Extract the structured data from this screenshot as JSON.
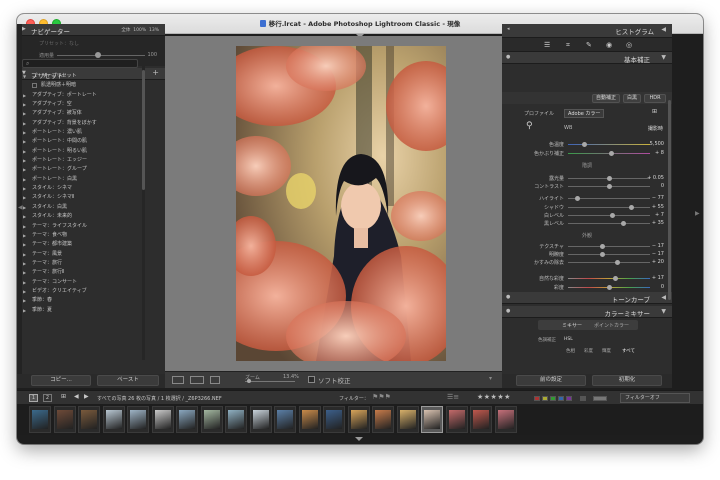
{
  "window": {
    "title": "移行.lrcat - Adobe Photoshop Lightroom Classic - 現像"
  },
  "navigator": {
    "header": "ナビゲーター",
    "zoom_fit": "全体",
    "zoom_100": "100%",
    "zoom_ratio": "13%",
    "preset_label": "プリセット：なし",
    "amount_label": "適用量",
    "amount_value": "100"
  },
  "presets": {
    "header": "プリセット",
    "search_placeholder": "",
    "items": [
      {
        "label": "ユーザープリセット",
        "type": "user"
      },
      {
        "label": "肌透明感＋明暗",
        "type": "sub"
      },
      {
        "label": "アダプティブ：ポートレート",
        "type": "item"
      },
      {
        "label": "アダプティブ：空",
        "type": "item"
      },
      {
        "label": "アダプティブ：被写体",
        "type": "item"
      },
      {
        "label": "アダプティブ：背景をぼかす",
        "type": "item"
      },
      {
        "label": "ポートレート：濃い肌",
        "type": "item"
      },
      {
        "label": "ポートレート：中間の肌",
        "type": "item"
      },
      {
        "label": "ポートレート：明るい肌",
        "type": "item"
      },
      {
        "label": "ポートレート：エッジー",
        "type": "item"
      },
      {
        "label": "ポートレート：グループ",
        "type": "item"
      },
      {
        "label": "ポートレート：白黒",
        "type": "item"
      },
      {
        "label": "スタイル：シネマ",
        "type": "item"
      },
      {
        "label": "スタイル：シネマⅡ",
        "type": "item"
      },
      {
        "label": "スタイル：白黒",
        "type": "item"
      },
      {
        "label": "スタイル：未来的",
        "type": "item"
      },
      {
        "label": "テーマ：ライフスタイル",
        "type": "item"
      },
      {
        "label": "テーマ：食べ物",
        "type": "item"
      },
      {
        "label": "テーマ：都市建築",
        "type": "item"
      },
      {
        "label": "テーマ：風景",
        "type": "item"
      },
      {
        "label": "テーマ：旅行",
        "type": "item"
      },
      {
        "label": "テーマ：旅行Ⅱ",
        "type": "item"
      },
      {
        "label": "テーマ：コンサート",
        "type": "item"
      },
      {
        "label": "ビデオ：クリエイティブ",
        "type": "item"
      },
      {
        "label": "季節：春",
        "type": "item"
      },
      {
        "label": "季節：夏",
        "type": "item"
      }
    ],
    "copy_button": "コピー...",
    "paste_button": "ペースト"
  },
  "toolbar": {
    "zoom_label": "ズーム",
    "zoom_value": "13.4%",
    "softproof_label": "ソフト校正"
  },
  "histogram": {
    "header": "ヒストグラム"
  },
  "basic": {
    "header": "基本補正",
    "auto_button": "自動補正",
    "bw_button": "白黒",
    "hdr_button": "HDR",
    "profile_label": "プロファイル",
    "profile_value": "Adobe カラー",
    "wb_label": "WB",
    "wb_value": "撮影時",
    "tone_heading": "階調",
    "presence_heading": "外観",
    "rows": [
      {
        "label": "色温度",
        "value": "5,500",
        "pos": 0.2
      },
      {
        "label": "色かぶり補正",
        "value": "+ 8",
        "pos": 0.53
      },
      {
        "label": "露光量",
        "value": "+ 0.05",
        "pos": 0.51
      },
      {
        "label": "コントラスト",
        "value": "0",
        "pos": 0.5
      },
      {
        "label": "ハイライト",
        "value": "− 77",
        "pos": 0.12
      },
      {
        "label": "シャドウ",
        "value": "+ 55",
        "pos": 0.77
      },
      {
        "label": "白レベル",
        "value": "+ 7",
        "pos": 0.54
      },
      {
        "label": "黒レベル",
        "value": "+ 35",
        "pos": 0.68
      },
      {
        "label": "テクスチャ",
        "value": "− 17",
        "pos": 0.42
      },
      {
        "label": "明瞭度",
        "value": "− 17",
        "pos": 0.42
      },
      {
        "label": "かすみの除去",
        "value": "+ 20",
        "pos": 0.6
      },
      {
        "label": "自然な彩度",
        "value": "+ 17",
        "pos": 0.58
      },
      {
        "label": "彩度",
        "value": "0",
        "pos": 0.5
      }
    ]
  },
  "tonecurve": {
    "header": "トーンカーブ"
  },
  "colormixer": {
    "header": "カラーミキサー",
    "tab_mixer": "ミキサー",
    "tab_point": "ポイントカラー",
    "adjust_label": "色調補正",
    "adjust_value": "HSL",
    "sub_tabs": [
      "色相",
      "彩度",
      "輝度",
      "すべて"
    ]
  },
  "right_buttons": {
    "previous": "前の設定",
    "reset": "初期化"
  },
  "filmstrip": {
    "page1": "1",
    "page2": "2",
    "path": "すべての写真  26 枚の写真 / 1 枚選択 / _Z6P3266.NEF",
    "filter_label": "フィルター：",
    "filter_value": "フィルターオフ",
    "thumb_colors": [
      "#3b6a8c",
      "#6e4a38",
      "#7a5a3c",
      "#b8c7d2",
      "#9eb4c6",
      "#c9c9c9",
      "#8aa7bf",
      "#a3b7a0",
      "#8fb0c2",
      "#c8d2da",
      "#5b7fa6",
      "#c98b4a",
      "#3c5f8a",
      "#d8a45a",
      "#c77b4a",
      "#d7b06a",
      "#d9c2b0",
      "#c36a6a",
      "#c0584d",
      "#c5707a"
    ],
    "selected_index": 16
  },
  "colors": {
    "accent_slider": "#a9a9a9",
    "label_red": "#d24b3b",
    "label_yellow": "#d8b83a",
    "label_green": "#4aa34a",
    "label_blue": "#3f6fc7",
    "label_purple": "#8a4fb0"
  }
}
